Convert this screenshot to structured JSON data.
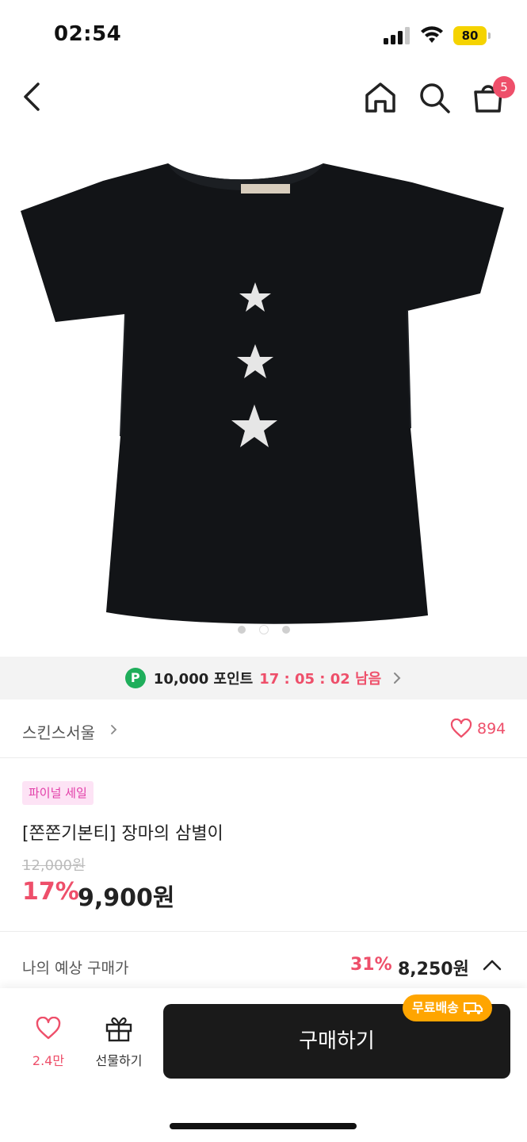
{
  "status": {
    "time": "02:54",
    "battery": "80"
  },
  "nav": {
    "cart_count": "5"
  },
  "gallery": {
    "active_index": 1,
    "count": 3
  },
  "points": {
    "icon_letter": "P",
    "amount": "10,000 포인트",
    "timer": "17 : 05 : 02 남음"
  },
  "store": {
    "name": "스킨스서울",
    "likes": "894"
  },
  "product": {
    "tag": "파이널 세일",
    "title": "[쫀쫀기본티] 장마의 삼별이",
    "original_price": "12,000원",
    "discount": "17%",
    "price": "9,900원"
  },
  "expected": {
    "label": "나의 예상 구매가",
    "discount": "31%",
    "price": "8,250원"
  },
  "bottom": {
    "wish_count": "2.4만",
    "gift_label": "선물하기",
    "buy_label": "구매하기",
    "shipping_badge": "무료배송"
  },
  "colors": {
    "accent": "#ee4f6a",
    "tag_bg": "#fde3f5",
    "tag_text": "#e23ea8",
    "points_green": "#1fae5b",
    "shipping": "#ffa500",
    "buy_bg": "#1a1a1a"
  }
}
